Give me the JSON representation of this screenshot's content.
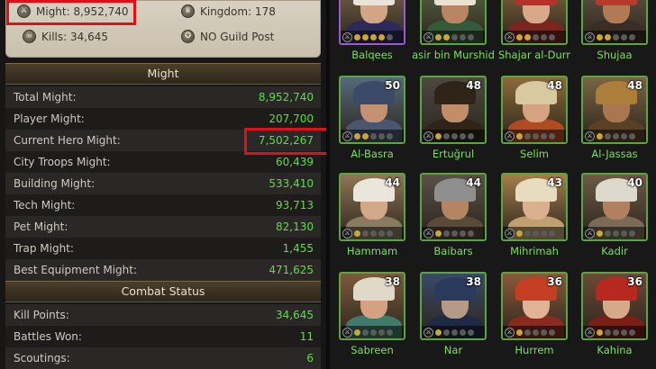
{
  "profile": {
    "might_label": "Might: 8,952,740",
    "kingdom_label": "Kingdom: 178",
    "kills_label": "Kills: 34,645",
    "guild_label": "NO Guild Post"
  },
  "might_section": {
    "title": "Might",
    "rows": [
      {
        "label": "Total Might:",
        "value": "8,952,740"
      },
      {
        "label": "Player Might:",
        "value": "207,700"
      },
      {
        "label": "Current Hero Might:",
        "value": "7,502,267"
      },
      {
        "label": "City Troops Might:",
        "value": "60,439"
      },
      {
        "label": "Building Might:",
        "value": "533,410"
      },
      {
        "label": "Tech Might:",
        "value": "93,713"
      },
      {
        "label": "Pet Might:",
        "value": "82,130"
      },
      {
        "label": "Trap Might:",
        "value": "1,455"
      },
      {
        "label": "Best Equipment Might:",
        "value": "471,625"
      }
    ]
  },
  "combat_section": {
    "title": "Combat Status",
    "rows": [
      {
        "label": "Kill Points:",
        "value": "34,645"
      },
      {
        "label": "Battles Won:",
        "value": "11"
      },
      {
        "label": "Scoutings:",
        "value": "6"
      }
    ]
  },
  "heroes": [
    {
      "name": "Balqees",
      "level": "",
      "rarity": "purple",
      "stars": 4
    },
    {
      "name": "asir bin Murshid",
      "level": "",
      "rarity": "green",
      "stars": 2
    },
    {
      "name": "Shajar al-Durr",
      "level": "",
      "rarity": "green",
      "stars": 2
    },
    {
      "name": "Shujaa",
      "level": "",
      "rarity": "green",
      "stars": 2
    },
    {
      "name": "Al-Basra",
      "level": "50",
      "rarity": "green",
      "stars": 2
    },
    {
      "name": "Ertuğrul",
      "level": "48",
      "rarity": "green",
      "stars": 1
    },
    {
      "name": "Selim",
      "level": "48",
      "rarity": "green",
      "stars": 1
    },
    {
      "name": "Al-Jassas",
      "level": "48",
      "rarity": "green",
      "stars": 1
    },
    {
      "name": "Hammam",
      "level": "44",
      "rarity": "green",
      "stars": 1
    },
    {
      "name": "Baibars",
      "level": "44",
      "rarity": "green",
      "stars": 1
    },
    {
      "name": "Mihrimah",
      "level": "43",
      "rarity": "green",
      "stars": 1
    },
    {
      "name": "Kadir",
      "level": "40",
      "rarity": "green",
      "stars": 1
    },
    {
      "name": "Sabreen",
      "level": "38",
      "rarity": "green",
      "stars": 1
    },
    {
      "name": "Nar",
      "level": "38",
      "rarity": "green",
      "stars": 1
    },
    {
      "name": "Hurrem",
      "level": "36",
      "rarity": "green",
      "stars": 1
    },
    {
      "name": "Kahina",
      "level": "36",
      "rarity": "green",
      "stars": 1
    }
  ],
  "colors": {
    "value_green": "#5fdc47",
    "highlight_red": "#e0101a",
    "hero_name_green": "#7be05e",
    "border_green": "#5aa53f",
    "border_purple": "#9a5ad6"
  },
  "icons": {
    "might": "crossed-swords-icon",
    "kingdom": "crown-icon",
    "kills": "skull-icon",
    "guild": "guild-crest-icon"
  }
}
